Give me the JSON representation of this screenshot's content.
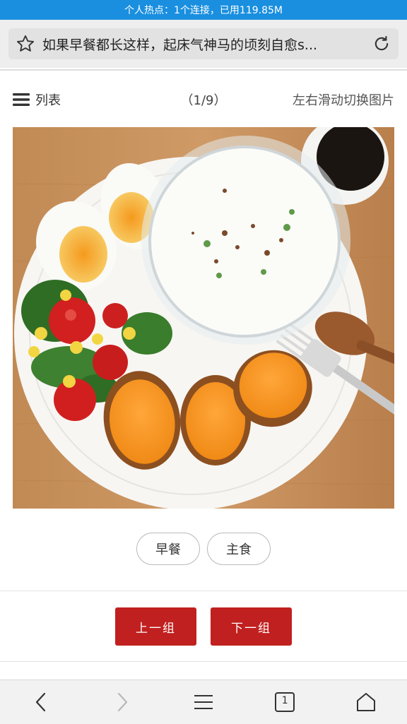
{
  "status_bar": {
    "hotspot_text": "个人热点：1个连接，已用119.85M"
  },
  "browser": {
    "page_title": "如果早餐都长这样，起床气神马的顷刻自愈s..."
  },
  "gallery": {
    "list_label": "列表",
    "counter": "（1/9）",
    "swipe_hint": "左右滑动切换图片",
    "tags": [
      "早餐",
      "主食"
    ],
    "prev_label": "上一组",
    "next_label": "下一组"
  },
  "bottom_nav": {
    "tab_count": "1"
  },
  "colors": {
    "status_bar": "#1a8fe0",
    "accent_button": "#c0201f"
  }
}
